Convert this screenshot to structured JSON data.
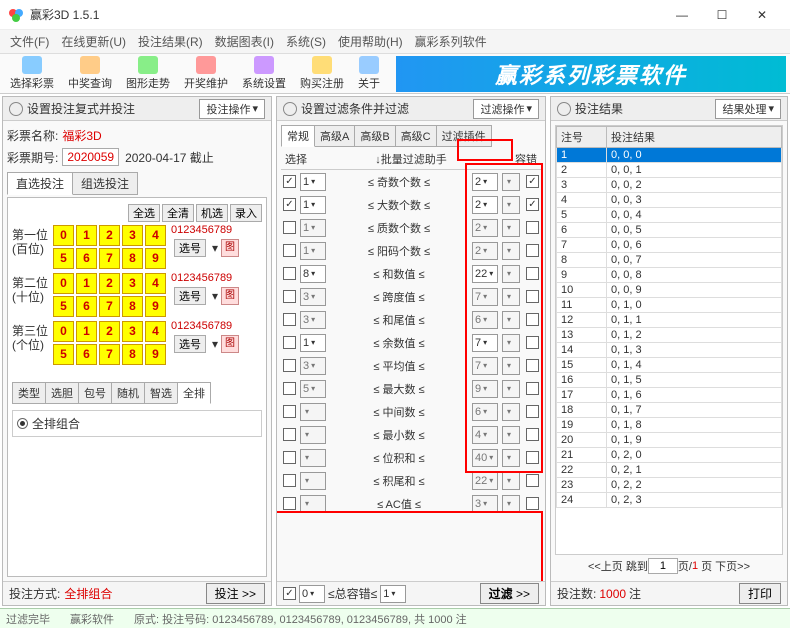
{
  "window": {
    "title": "赢彩3D 1.5.1"
  },
  "menu": [
    "文件(F)",
    "在线更新(U)",
    "投注结果(R)",
    "数据图表(I)",
    "系统(S)",
    "使用帮助(H)",
    "赢彩系列软件"
  ],
  "toolbar": [
    "选择彩票",
    "中奖查询",
    "图形走势",
    "开奖维护",
    "系统设置",
    "购买注册",
    "关于"
  ],
  "banner": "赢彩系列彩票软件",
  "left": {
    "title": "设置投注复式并投注",
    "op": "投注操作",
    "lottery_label": "彩票名称:",
    "lottery_name": "福彩3D",
    "period_label": "彩票期号:",
    "period": "2020059",
    "deadline": "2020-04-17 截止",
    "tabs": [
      "直选投注",
      "组选投注"
    ],
    "btns": [
      "全选",
      "全清",
      "机选",
      "录入"
    ],
    "positions": [
      {
        "label1": "第一位",
        "label2": "(百位)"
      },
      {
        "label1": "第二位",
        "label2": "(十位)"
      },
      {
        "label1": "第三位",
        "label2": "(个位)"
      }
    ],
    "digits_str": "0123456789",
    "xuanhao": "选号",
    "imgbtn": "图",
    "subtabs": [
      "类型",
      "选胆",
      "包号",
      "随机",
      "智选",
      "全排"
    ],
    "radio_label": "全排组合",
    "footer_label": "投注方式:",
    "footer_value": "全排组合",
    "footer_btn": "投注"
  },
  "center": {
    "title": "设置过滤条件并过滤",
    "op": "过滤操作",
    "tabs": [
      "常规",
      "高级A",
      "高级B",
      "高级C",
      "过滤插件"
    ],
    "head": {
      "sel": "选择",
      "helper": "↓批量过滤助手",
      "rc": "容错"
    },
    "filters": [
      {
        "chk": true,
        "v1": "1",
        "name": "≤ 奇数个数 ≤",
        "v2": "2",
        "active": true,
        "rc": true
      },
      {
        "chk": true,
        "v1": "1",
        "name": "≤ 大数个数 ≤",
        "v2": "2",
        "active": true,
        "rc": true
      },
      {
        "chk": false,
        "v1": "1",
        "name": "≤ 质数个数 ≤",
        "v2": "2",
        "active": false,
        "rc": false
      },
      {
        "chk": false,
        "v1": "1",
        "name": "≤ 阳码个数 ≤",
        "v2": "2",
        "active": false,
        "rc": false
      },
      {
        "chk": false,
        "v1": "8",
        "name": "≤  和数值  ≤",
        "v2": "22",
        "active": true,
        "rc": false
      },
      {
        "chk": false,
        "v1": "3",
        "name": "≤  跨度值  ≤",
        "v2": "7",
        "active": false,
        "rc": false
      },
      {
        "chk": false,
        "v1": "3",
        "name": "≤  和尾值  ≤",
        "v2": "6",
        "active": false,
        "rc": false
      },
      {
        "chk": false,
        "v1": "1",
        "name": "≤  余数值  ≤",
        "v2": "7",
        "active": true,
        "rc": false
      },
      {
        "chk": false,
        "v1": "3",
        "name": "≤  平均值  ≤",
        "v2": "7",
        "active": false,
        "rc": false
      },
      {
        "chk": false,
        "v1": "5",
        "name": "≤  最大数  ≤",
        "v2": "9",
        "active": false,
        "rc": false
      },
      {
        "chk": false,
        "v1": "",
        "name": "≤  中间数  ≤",
        "v2": "6",
        "active": false,
        "rc": false
      },
      {
        "chk": false,
        "v1": "",
        "name": "≤  最小数  ≤",
        "v2": "4",
        "active": false,
        "rc": false
      },
      {
        "chk": false,
        "v1": "",
        "name": "≤  位积和  ≤",
        "v2": "40",
        "active": false,
        "rc": false
      },
      {
        "chk": false,
        "v1": "",
        "name": "≤  积尾和  ≤",
        "v2": "22",
        "active": false,
        "rc": false
      },
      {
        "chk": false,
        "v1": "",
        "name": "≤   AC值   ≤",
        "v2": "3",
        "active": false,
        "rc": false
      }
    ],
    "footer": {
      "lbl1": "≤总容错≤",
      "v1": "0",
      "v2": "1",
      "btn": "过滤",
      "arrow": ">>"
    }
  },
  "right": {
    "title": "投注结果",
    "op": "结果处理",
    "cols": [
      "注号",
      "投注结果"
    ],
    "rows": [
      [
        "1",
        "0, 0, 0"
      ],
      [
        "2",
        "0, 0, 1"
      ],
      [
        "3",
        "0, 0, 2"
      ],
      [
        "4",
        "0, 0, 3"
      ],
      [
        "5",
        "0, 0, 4"
      ],
      [
        "6",
        "0, 0, 5"
      ],
      [
        "7",
        "0, 0, 6"
      ],
      [
        "8",
        "0, 0, 7"
      ],
      [
        "9",
        "0, 0, 8"
      ],
      [
        "10",
        "0, 0, 9"
      ],
      [
        "11",
        "0, 1, 0"
      ],
      [
        "12",
        "0, 1, 1"
      ],
      [
        "13",
        "0, 1, 2"
      ],
      [
        "14",
        "0, 1, 3"
      ],
      [
        "15",
        "0, 1, 4"
      ],
      [
        "16",
        "0, 1, 5"
      ],
      [
        "17",
        "0, 1, 6"
      ],
      [
        "18",
        "0, 1, 7"
      ],
      [
        "19",
        "0, 1, 8"
      ],
      [
        "20",
        "0, 1, 9"
      ],
      [
        "21",
        "0, 2, 0"
      ],
      [
        "22",
        "0, 2, 1"
      ],
      [
        "23",
        "0, 2, 2"
      ],
      [
        "24",
        "0, 2, 3"
      ]
    ],
    "pager": {
      "prev": "<<上页",
      "jump": "跳到",
      "page": "1",
      "of_label": "页/",
      "total": "1",
      "next": "页 下页>>"
    },
    "footer": {
      "label": "投注数:",
      "count": "1000",
      "unit": "注",
      "btn": "打印"
    }
  },
  "status": {
    "left": "过滤完毕",
    "app": "赢彩软件",
    "right": "原式: 投注号码: 0123456789, 0123456789, 0123456789, 共 1000 注"
  }
}
